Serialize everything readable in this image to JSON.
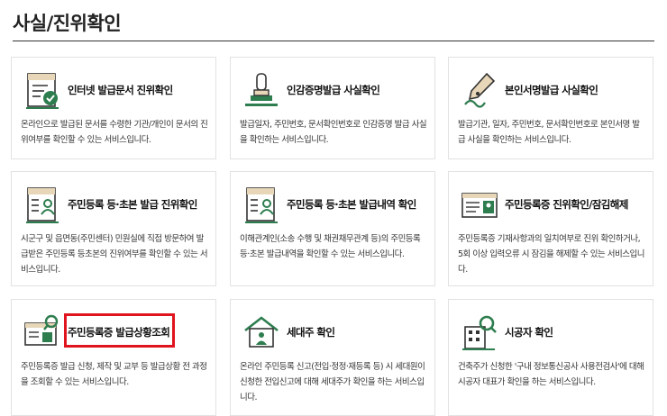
{
  "page": {
    "title": "사실/진위확인"
  },
  "colors": {
    "accent_green": "#2e7d4f",
    "highlight_red": "#e0141e",
    "border": "#e2e2e2"
  },
  "services": [
    {
      "title": "인터넷 발급문서 진위확인",
      "desc": "온라인으로 발급된 문서를 수령한 기관/개인이 문서의 진위여부를 확인할 수 있는 서비스입니다.",
      "icon": "certificate-check-icon"
    },
    {
      "title": "인감증명발급 사실확인",
      "desc": "발급일자, 주민번호, 문서확인번호로 인감증명 발급 사실을 확인하는 서비스입니다.",
      "icon": "seal-stamp-icon"
    },
    {
      "title": "본인서명발급 사실확인",
      "desc": "발급기관, 일자, 주민번호, 문서확인번호로 본인서명 발급 사실을 확인하는 서비스입니다.",
      "icon": "pen-signature-icon"
    },
    {
      "title": "주민등록 등·초본 발급 진위확인",
      "desc": "시군구 및 읍면동(주민센터) 민원실에 직접 방문하여 발급받은 주민등록 등초본의 진위여부를 확인할 수 있는 서비스입니다.",
      "icon": "resident-document-icon"
    },
    {
      "title": "주민등록 등·초본 발급내역 확인",
      "desc": "이해관계인(소송 수행 및 채권채무관계 등)의 주민등록 등·초본 발급내역을 확인할 수 있는 서비스입니다.",
      "icon": "resident-document-icon"
    },
    {
      "title": "주민등록증 진위확인/잠김해제",
      "desc": "주민등록증 기재사항과의 일치여부로 진위 확인하거나, 5회 이상 입력오류 시 잠김을 해제할 수 있는 서비스입니다.",
      "icon": "id-card-icon"
    },
    {
      "title": "주민등록증 발급상황조회",
      "desc": "주민등록증 발급 신청, 제작 및 교부 등 발급상황 전 과정을 조회할 수 있는 서비스입니다.",
      "icon": "id-card-search-icon"
    },
    {
      "title": "세대주 확인",
      "desc": "온라인 주민등록 신고(전입·정정·재등록 등) 시 세대원이 신청한 전입신고에 대해 세대주가 확인을 하는 서비스입니다.",
      "icon": "house-person-icon"
    },
    {
      "title": "시공자 확인",
      "desc": "건축주가 신청한 '구내 정보통신공사 사용전검사'에 대해 시공자 대표가 확인을 하는 서비스입니다.",
      "icon": "building-search-icon"
    }
  ]
}
